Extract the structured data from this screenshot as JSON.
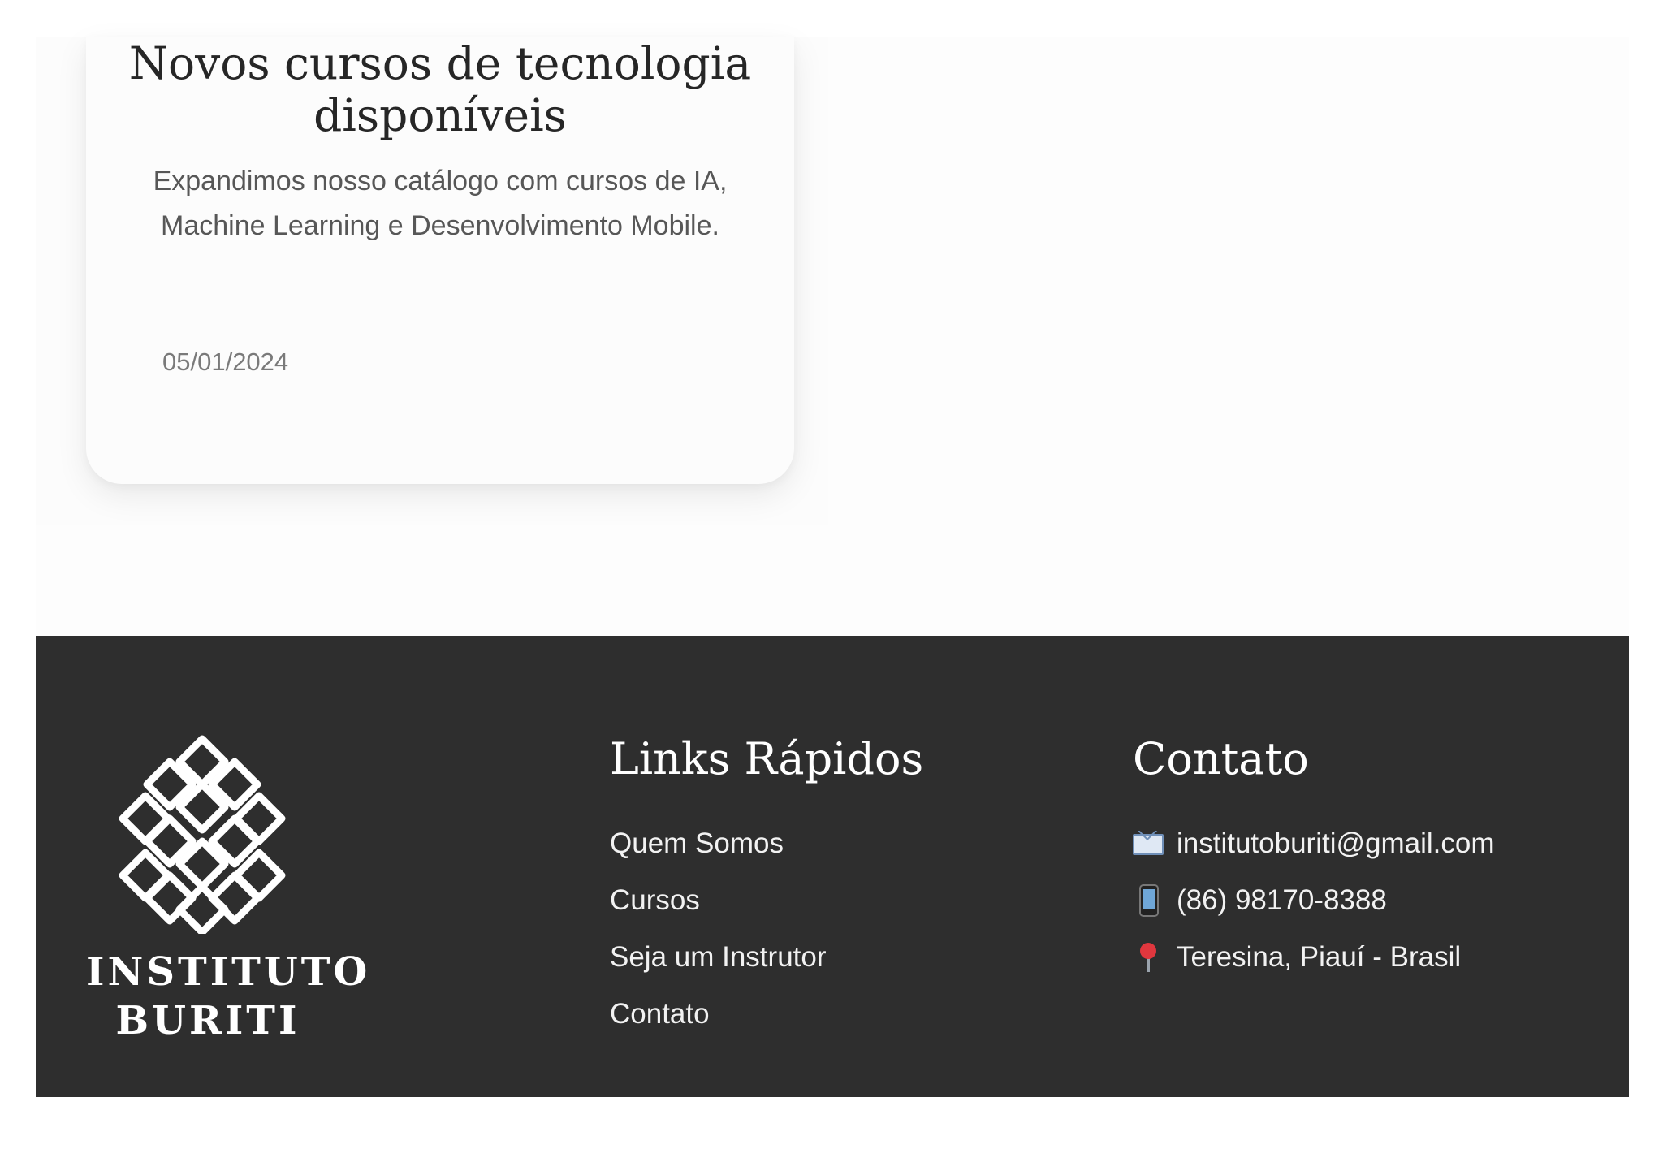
{
  "news_card": {
    "title": "Novos cursos de tecnologia disponíveis",
    "description": "Expandimos nosso catálogo com cursos de IA, Machine Learning e Desenvolvimento Mobile.",
    "date": "05/01/2024"
  },
  "footer": {
    "logo": {
      "line1": "INSTITUTO",
      "line2": "BURITI"
    },
    "quick_links": {
      "heading": "Links Rápidos",
      "items": [
        "Quem Somos",
        "Cursos",
        "Seja um Instrutor",
        "Contato"
      ]
    },
    "contact": {
      "heading": "Contato",
      "email": "institutoburiti@gmail.com",
      "phone": "(86) 98170-8388",
      "location": "Teresina, Piauí - Brasil",
      "icons": {
        "email": "envelope-icon",
        "phone": "mobile-phone-icon",
        "location": "round-pushpin-icon"
      }
    }
  },
  "colors": {
    "footer_background": "#2e2e2e",
    "card_background": "#fcfcfc",
    "title_text": "#262626",
    "body_text": "#575757"
  }
}
